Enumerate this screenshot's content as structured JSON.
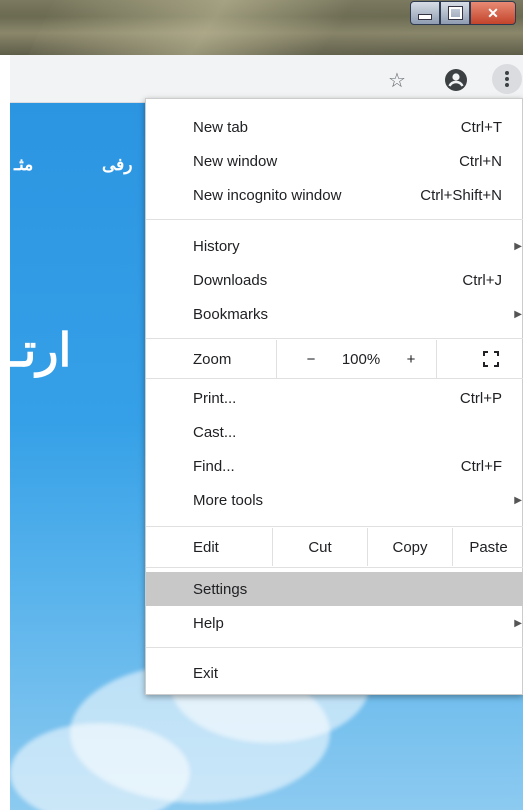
{
  "window_controls": {
    "minimize": "minimize",
    "maximize": "maximize",
    "close": "close"
  },
  "toolbar": {
    "bookmark_icon": "star-icon",
    "account_icon": "account-icon",
    "menu_icon": "kebab-menu-icon"
  },
  "page": {
    "nav_fragment_left": "مثـ",
    "nav_fragment_right": "رفی",
    "hero_fragment": "ارتـ"
  },
  "menu": {
    "new_tab": {
      "label": "New tab",
      "shortcut": "Ctrl+T"
    },
    "new_window": {
      "label": "New window",
      "shortcut": "Ctrl+N"
    },
    "new_incognito": {
      "label": "New incognito window",
      "shortcut": "Ctrl+Shift+N"
    },
    "history": {
      "label": "History"
    },
    "downloads": {
      "label": "Downloads",
      "shortcut": "Ctrl+J"
    },
    "bookmarks": {
      "label": "Bookmarks"
    },
    "zoom": {
      "label": "Zoom",
      "minus": "−",
      "level": "100%",
      "plus": "+"
    },
    "print": {
      "label": "Print...",
      "shortcut": "Ctrl+P"
    },
    "cast": {
      "label": "Cast..."
    },
    "find": {
      "label": "Find...",
      "shortcut": "Ctrl+F"
    },
    "more_tools": {
      "label": "More tools"
    },
    "edit": {
      "label": "Edit",
      "cut": "Cut",
      "copy": "Copy",
      "paste": "Paste"
    },
    "settings": {
      "label": "Settings"
    },
    "help": {
      "label": "Help"
    },
    "exit": {
      "label": "Exit"
    }
  },
  "colors": {
    "page_blue": "#2c95e2",
    "highlight": "#c8c8c8"
  }
}
